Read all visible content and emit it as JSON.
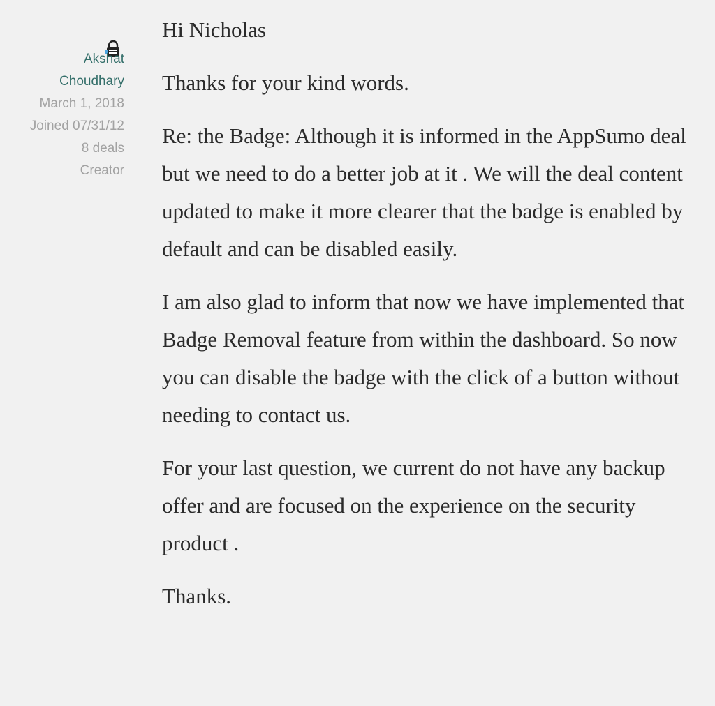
{
  "author": {
    "first_name": "Akshat",
    "last_name": "Choudhary",
    "date": "March 1, 2018",
    "joined": "Joined 07/31/12",
    "deals": "8 deals",
    "role": "Creator",
    "avatar_icon": "avatar-lock-icon",
    "name_color": "#346f6a",
    "meta_color": "#a2a2a2"
  },
  "message": {
    "greeting": "Hi Nicholas",
    "p1": "Thanks for your kind words.",
    "p2": "Re: the Badge: Although it is informed in the AppSumo deal but we need to do a better job at it . We will the deal content updated to make it more clearer that the badge is enabled by default and can be disabled easily.",
    "p3": "I am also glad to inform that now we have implemented that Badge Removal feature from within the dashboard. So now you can disable the badge with the click of a button without needing to contact us.",
    "p4": "For your last question, we current do not have any backup offer and are focused on the experience on the security product .",
    "closing": "Thanks."
  }
}
